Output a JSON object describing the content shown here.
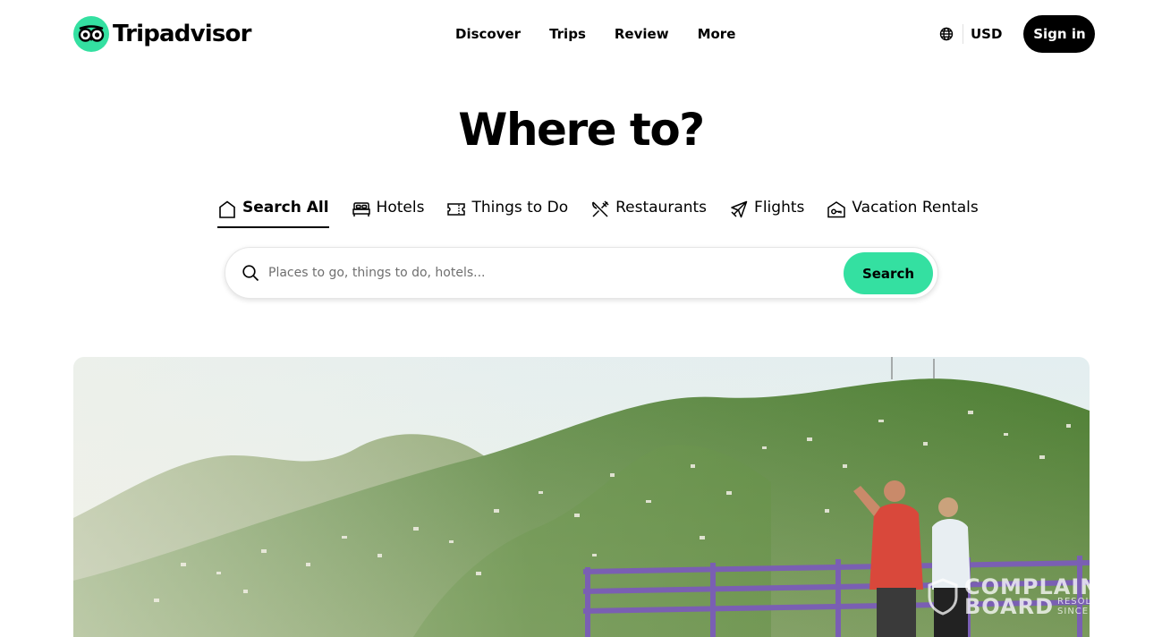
{
  "header": {
    "logo_text": "Tripadvisor",
    "nav": [
      "Discover",
      "Trips",
      "Review",
      "More"
    ],
    "currency": "USD",
    "sign_in": "Sign in"
  },
  "hero": {
    "title": "Where to?"
  },
  "tabs": [
    {
      "label": "Search All",
      "icon": "home-icon",
      "active": true
    },
    {
      "label": "Hotels",
      "icon": "bed-icon",
      "active": false
    },
    {
      "label": "Things to Do",
      "icon": "ticket-icon",
      "active": false
    },
    {
      "label": "Restaurants",
      "icon": "utensils-icon",
      "active": false
    },
    {
      "label": "Flights",
      "icon": "plane-icon",
      "active": false
    },
    {
      "label": "Vacation Rentals",
      "icon": "house-key-icon",
      "active": false
    }
  ],
  "search": {
    "placeholder": "Places to go, things to do, hotels...",
    "button": "Search"
  },
  "watermark": {
    "line1": "COMPLAIN",
    "line2": "BOARD",
    "sub1": "RESOLV",
    "sub2": "SINCE"
  },
  "colors": {
    "brand_green": "#34e0a1",
    "text": "#000000"
  }
}
